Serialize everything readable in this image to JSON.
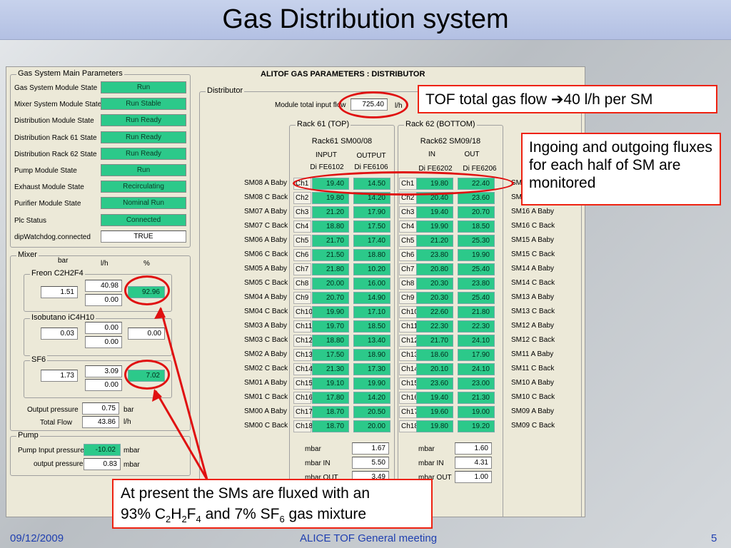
{
  "slide": {
    "title": "Gas Distribution system",
    "footer_date": "09/12/2009",
    "footer_center": "ALICE TOF General meeting",
    "page_number": "5"
  },
  "panel": {
    "main_title": "ALITOF GAS PARAMETERS : DISTRIBUTOR",
    "gsmp": {
      "title": "Gas System Main Parameters",
      "rows": [
        {
          "label": "Gas System Module State",
          "value": "Run"
        },
        {
          "label": "Mixer System Module State",
          "value": "Run Stable"
        },
        {
          "label": "Distribution Module State",
          "value": "Run Ready"
        },
        {
          "label": "Distribution Rack 61 State",
          "value": "Run Ready"
        },
        {
          "label": "Distribution Rack 62 State",
          "value": "Run Ready"
        },
        {
          "label": "Pump Module State",
          "value": "Run"
        },
        {
          "label": "Exhaust Module State",
          "value": "Recirculating"
        },
        {
          "label": "Purifier Module State",
          "value": "Nominal Run"
        },
        {
          "label": "Plc Status",
          "value": "Connected"
        },
        {
          "label": "dipWatchdog.connected",
          "value": "TRUE"
        }
      ]
    },
    "mixer": {
      "title": "Mixer",
      "col_bar": "bar",
      "col_lh": "l/h",
      "col_pct": "%",
      "freon": {
        "title": "Freon  C2H2F4",
        "bar": "1.51",
        "lh1": "40.98",
        "lh2": "0.00",
        "pct": "92.96"
      },
      "isobutane": {
        "title": "Isobutano iC4H10",
        "bar": "0.03",
        "lh1": "0.00",
        "lh2": "0.00",
        "pct": "0.00"
      },
      "sf6": {
        "title": "SF6",
        "bar": "1.73",
        "lh1": "3.09",
        "lh2": "0.00",
        "pct": "7.02"
      },
      "output_pressure_label": "Output pressure",
      "output_pressure": "0.75",
      "output_pressure_unit": "bar",
      "total_flow_label": "Total Flow",
      "total_flow": "43.86",
      "total_flow_unit": "l/h"
    },
    "pump": {
      "title": "Pump",
      "input_label": "Pump Input pressure",
      "input_value": "-10.02",
      "input_unit": "mbar",
      "output_label": "output pressure",
      "output_value": "0.83",
      "output_unit": "mbar"
    },
    "distributor": {
      "title": "Distributor",
      "module_input_label": "Module total input flow",
      "module_input_value": "725.40",
      "module_input_unit": "l/h",
      "rack61": {
        "title": "Rack 61 (TOP)",
        "subtitle": "Rack61 SM00/08",
        "col_in": "INPUT",
        "col_out": "OUTPUT",
        "in_id": "Di FE6102",
        "out_id": "Di FE6106",
        "mbar_label": "mbar",
        "mbar_value": "1.67",
        "mbar_in_label": "mbar IN",
        "mbar_in_value": "5.50",
        "mbar_out_label": "mbar OUT",
        "mbar_out_value": "3.49"
      },
      "rack62": {
        "title": "Rack 62 (BOTTOM)",
        "subtitle": "Rack62 SM09/18",
        "col_in": "IN",
        "col_out": "OUT",
        "in_id": "Di FE6202",
        "out_id": "Di FE6206",
        "mbar_label": "mbar",
        "mbar_value": "1.60",
        "mbar_in_label": "mbar IN",
        "mbar_in_value": "4.31",
        "mbar_out_label": "mbar OUT",
        "mbar_out_value": "1.00"
      },
      "left_sm": [
        "SM08 A Baby",
        "SM08 C Back",
        "SM07 A Baby",
        "SM07 C Back",
        "SM06 A Baby",
        "SM06 C Back",
        "SM05 A Baby",
        "SM05 C Back",
        "SM04 A Baby",
        "SM04 C Back",
        "SM03 A Baby",
        "SM03 C Back",
        "SM02 A Baby",
        "SM02 C Back",
        "SM01 A Baby",
        "SM01 C Back",
        "SM00 A Baby",
        "SM00 C Back"
      ],
      "right_sm": [
        "SM",
        "SM",
        "SM16 A Baby",
        "SM16 C Back",
        "SM15 A Baby",
        "SM15 C Back",
        "SM14 A Baby",
        "SM14 C Back",
        "SM13 A Baby",
        "SM13 C Back",
        "SM12 A Baby",
        "SM12 C Back",
        "SM11 A Baby",
        "SM11 C Back",
        "SM10 A Baby",
        "SM10 C Back",
        "SM09 A Baby",
        "SM09 C Back"
      ],
      "channels": [
        "Ch1",
        "Ch2",
        "Ch3",
        "Ch4",
        "Ch5",
        "Ch6",
        "Ch7",
        "Ch8",
        "Ch9",
        "Ch10",
        "Ch11",
        "Ch12",
        "Ch13",
        "Ch14",
        "Ch15",
        "Ch16",
        "Ch17",
        "Ch18"
      ],
      "r61_in": [
        "19.40",
        "19.80",
        "21.20",
        "18.80",
        "21.70",
        "21.50",
        "21.80",
        "20.00",
        "20.70",
        "19.90",
        "19.70",
        "18.80",
        "17.50",
        "21.30",
        "19.10",
        "17.80",
        "18.70",
        "18.70"
      ],
      "r61_out": [
        "14.50",
        "14.20",
        "17.90",
        "17.50",
        "17.40",
        "18.80",
        "10.20",
        "16.00",
        "14.90",
        "17.10",
        "18.50",
        "13.40",
        "18.90",
        "17.30",
        "19.90",
        "14.20",
        "20.50",
        "20.00"
      ],
      "r62_in": [
        "19.80",
        "20.40",
        "19.40",
        "19.90",
        "21.20",
        "23.80",
        "20.80",
        "20.30",
        "20.30",
        "22.60",
        "22.30",
        "21.70",
        "18.60",
        "20.10",
        "23.60",
        "19.40",
        "19.60",
        "19.80"
      ],
      "r62_out": [
        "22.40",
        "23.60",
        "20.70",
        "18.50",
        "25.30",
        "19.90",
        "25.40",
        "23.80",
        "25.40",
        "21.80",
        "22.30",
        "24.10",
        "17.90",
        "24.10",
        "23.00",
        "21.30",
        "19.00",
        "19.20"
      ]
    }
  },
  "callouts": {
    "flow": "TOF total gas flow ➔40 l/h per SM",
    "fluxes": "Ingoing and outgoing fluxes for each half of SM are monitored",
    "mix_line1": "At present the SMs are fluxed with an",
    "mix_pre": "93% C",
    "mix_s1": "2",
    "mix_h": "H",
    "mix_s2": "2",
    "mix_f": "F",
    "mix_s3": "4",
    "mix_mid": " and 7% SF",
    "mix_s4": "6",
    "mix_post": " gas mixture"
  },
  "colors": {
    "green_cell": "#2cc98a",
    "annotation_red": "#e01010",
    "footer_blue": "#1f3fb0"
  }
}
